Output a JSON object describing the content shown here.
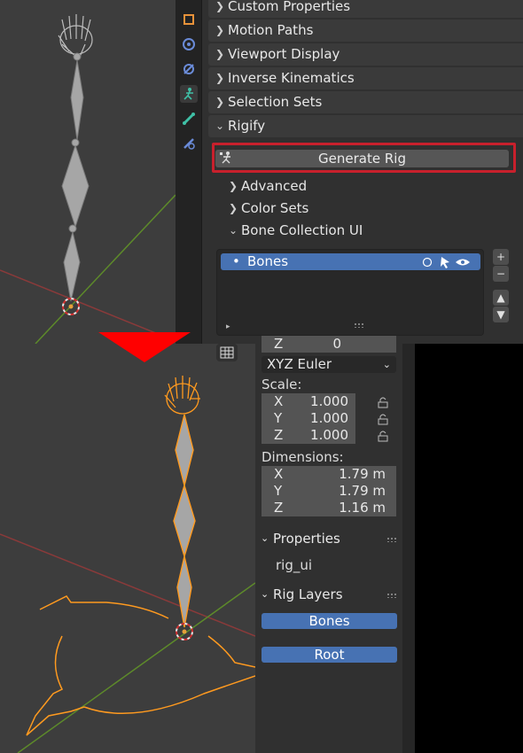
{
  "properties_panel": {
    "panels": [
      {
        "label": "Custom Properties",
        "expanded": false
      },
      {
        "label": "Motion Paths",
        "expanded": false
      },
      {
        "label": "Viewport Display",
        "expanded": false
      },
      {
        "label": "Inverse Kinematics",
        "expanded": false
      },
      {
        "label": "Selection Sets",
        "expanded": false
      },
      {
        "label": "Rigify",
        "expanded": true
      }
    ],
    "generate_button": "Generate Rig",
    "subpanels": [
      "Advanced",
      "Color Sets",
      "Bone Collection UI"
    ],
    "bone_list": {
      "items": [
        "Bones"
      ]
    },
    "side_buttons": [
      "+",
      "−",
      "▲",
      "▼"
    ]
  },
  "side_panel": {
    "partial_row": "Z",
    "partial_value": "0",
    "rotation_mode": "XYZ Euler",
    "scale_label": "Scale:",
    "scale": [
      {
        "axis": "X",
        "value": "1.000"
      },
      {
        "axis": "Y",
        "value": "1.000"
      },
      {
        "axis": "Z",
        "value": "1.000"
      }
    ],
    "dimensions_label": "Dimensions:",
    "dimensions": [
      {
        "axis": "X",
        "value": "1.79 m"
      },
      {
        "axis": "Y",
        "value": "1.79 m"
      },
      {
        "axis": "Z",
        "value": "1.16 m"
      }
    ],
    "properties_header": "Properties",
    "property_item": "rig_ui",
    "rig_layers_header": "Rig Layers",
    "layer_buttons": [
      "Bones",
      "Root"
    ]
  },
  "colors": {
    "accent_blue": "#4772b3",
    "highlight_red": "#c8202c",
    "selection_orange": "#ff9a1f"
  }
}
